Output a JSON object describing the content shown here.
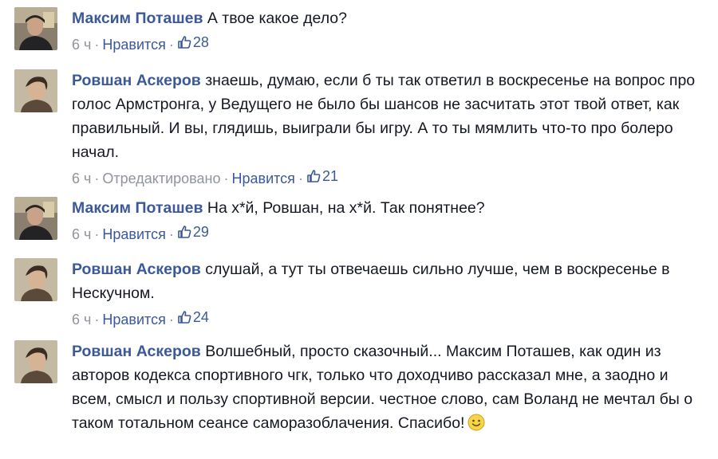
{
  "comments": [
    {
      "author": "Максим Поташев",
      "text": "А твое какое дело?",
      "time": "6 ч",
      "edited": "",
      "like_label": "Нравится",
      "like_count": "28"
    },
    {
      "author": "Ровшан Аскеров",
      "text": "знаешь, думаю, если б ты так ответил в воскресенье на вопрос про голос Армстронга, у Ведущего не было бы шансов не засчитать этот твой ответ, как правильный. И вы, глядишь, выиграли бы игру. А то ты мямлить что-то про болеро начал.",
      "time": "6 ч",
      "edited": "Отредактировано",
      "like_label": "Нравится",
      "like_count": "21"
    },
    {
      "author": "Максим Поташев",
      "text": "На х*й, Ровшан, на х*й. Так понятнее?",
      "time": "6 ч",
      "edited": "",
      "like_label": "Нравится",
      "like_count": "29"
    },
    {
      "author": "Ровшан Аскеров",
      "text": "слушай, а тут ты отвечаешь сильно лучше, чем в воскресенье в Нескучном.",
      "time": "6 ч",
      "edited": "",
      "like_label": "Нравится",
      "like_count": "24"
    },
    {
      "author": "Ровшан Аскеров",
      "text": "Волшебный, просто сказочный... Максим Поташев, как один из авторов кодекса спортивного чгк, только что доходчиво рассказал мне, а заодно и всем, смысл и пользу спортивной версии. честное слово, сам Воланд не мечтал бы о таком тотальном сеансе саморазоблачения. Спасибо!",
      "time": "",
      "edited": "",
      "like_label": "",
      "like_count": ""
    }
  ],
  "colors": {
    "link": "#3b5998",
    "meta": "#90949c",
    "text": "#141823"
  },
  "icons": {
    "like": "thumbs-up-icon",
    "emoji": "smiley-face-icon"
  }
}
